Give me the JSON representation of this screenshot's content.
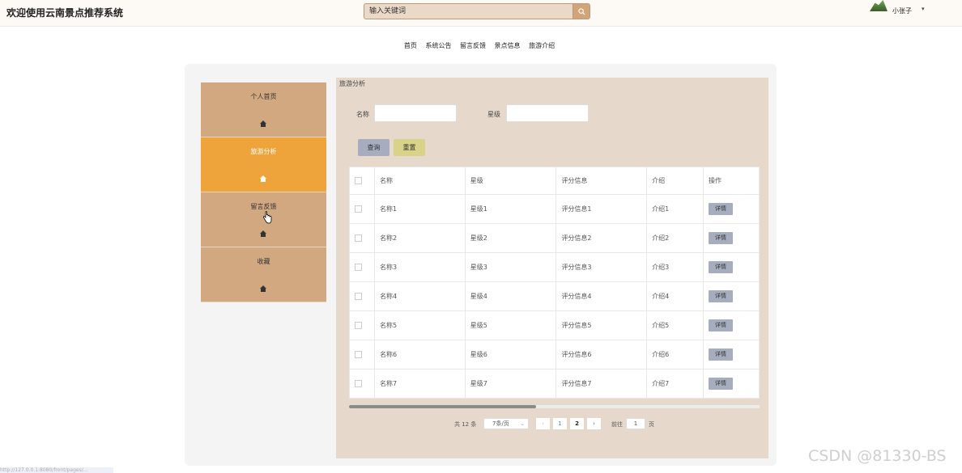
{
  "header": {
    "site_title": "欢迎使用云南景点推荐系统",
    "search_placeholder": "输入关键词",
    "username": "小张子",
    "caret": "▾"
  },
  "nav": [
    "首页",
    "系统公告",
    "留言反馈",
    "景点信息",
    "旅游介绍"
  ],
  "sidebar": {
    "items": [
      {
        "label": "个人首页",
        "active": false
      },
      {
        "label": "旅游分析",
        "active": true
      },
      {
        "label": "留言反馈",
        "active": false
      },
      {
        "label": "收藏",
        "active": false
      }
    ]
  },
  "panel": {
    "title": "旅游分析",
    "filters": {
      "name_label": "名称",
      "level_label": "星级"
    },
    "query_button": "查询",
    "reset_button": "重置",
    "table": {
      "headers": [
        "名称",
        "星级",
        "评分信息",
        "介绍",
        "操作"
      ],
      "rows": [
        [
          "名称1",
          "星级1",
          "评分信息1",
          "介绍1"
        ],
        [
          "名称2",
          "星级2",
          "评分信息2",
          "介绍2"
        ],
        [
          "名称3",
          "星级3",
          "评分信息3",
          "介绍3"
        ],
        [
          "名称4",
          "星级4",
          "评分信息4",
          "介绍4"
        ],
        [
          "名称5",
          "星级5",
          "评分信息5",
          "介绍5"
        ],
        [
          "名称6",
          "星级6",
          "评分信息6",
          "介绍6"
        ],
        [
          "名称7",
          "星级7",
          "评分信息7",
          "介绍7"
        ]
      ],
      "detail_label": "详情"
    },
    "pagination": {
      "total": "共 12 条",
      "page_size": "7条/页",
      "pages": [
        "1",
        "2"
      ],
      "goto_prefix": "前往",
      "goto_value": "1",
      "goto_suffix": "页"
    }
  },
  "watermark": "CSDN @81330-BS",
  "status_url": "http://127.0.0.1:8080/front/pages/..."
}
